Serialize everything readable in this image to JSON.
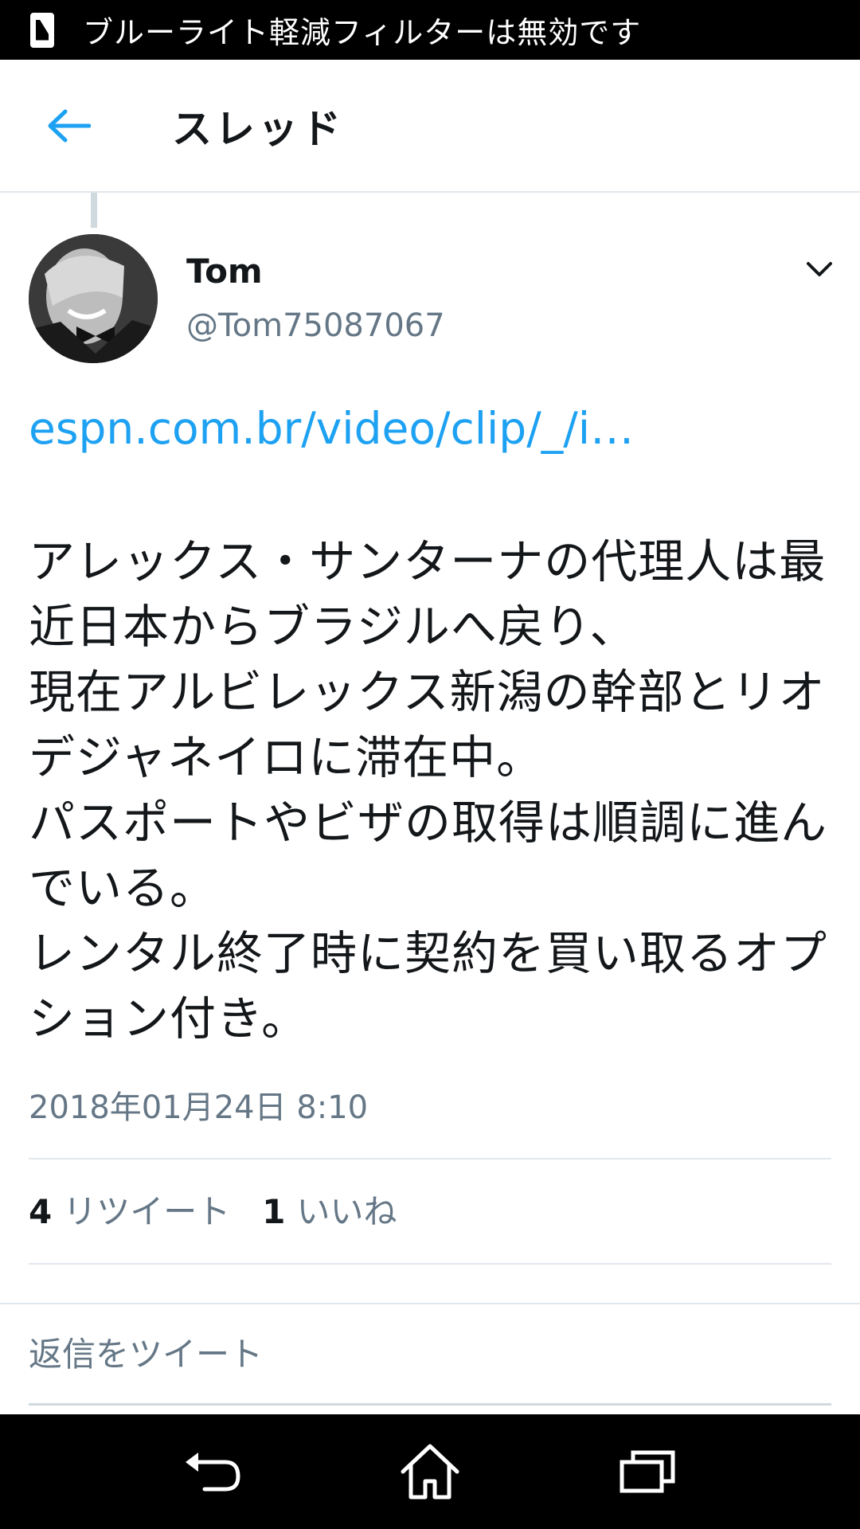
{
  "status_bar": {
    "icon": "bluelight-filter-icon",
    "text": "ブルーライト軽減フィルターは無効です"
  },
  "header": {
    "back_icon": "back-arrow-icon",
    "title": "スレッド"
  },
  "tweet": {
    "author_name": "Tom",
    "author_handle": "@Tom75087067",
    "more_icon": "chevron-down-icon",
    "link": "espn.com.br/video/clip/_/i…",
    "text": "アレックス・サンターナの代理人は最近日本からブラジルへ戻り、\n現在アルビレックス新潟の幹部とリオデジャネイロに滞在中。\nパスポートやビザの取得は順調に進んでいる。\nレンタル終了時に契約を買い取るオプション付き。",
    "timestamp": "2018年01月24日 8:10",
    "retweets_count": "4",
    "retweets_label": "リツイート",
    "likes_count": "1",
    "likes_label": "いいね"
  },
  "reply": {
    "placeholder": "返信をツイート"
  },
  "nav": {
    "back_icon": "back-icon",
    "home_icon": "home-icon",
    "recents_icon": "recents-icon"
  },
  "colors": {
    "accent": "#1da1f2",
    "secondary_text": "#657786",
    "divider": "#e1e8ed"
  }
}
